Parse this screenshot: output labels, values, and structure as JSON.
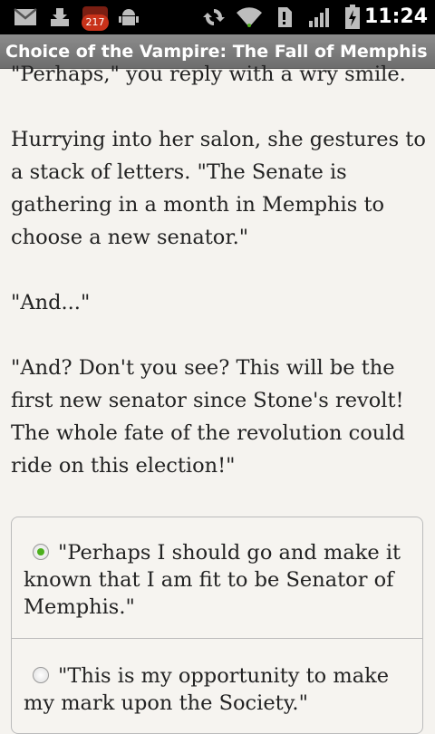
{
  "status_bar": {
    "notification_count": "217",
    "time": "11:24",
    "icons": [
      "gmail-icon",
      "download-icon",
      "app-notification-icon",
      "android-debug-icon",
      "sync-icon",
      "wifi-icon",
      "alert-icon",
      "signal-icon",
      "battery-charging-icon"
    ]
  },
  "title_bar": {
    "title": "Choice of the Vampire: The Fall of Memphis"
  },
  "story": {
    "paragraphs": [
      "\"Perhaps,\" you reply with a wry smile.",
      "Hurrying into her salon, she gestures to a stack of letters. \"The Senate is gathering in a month in Memphis to choose a new senator.\"",
      "\"And...\"",
      "\"And? Don't you see? This will be the first new senator since Stone's revolt! The whole fate of the revolution could ride on this election!\""
    ]
  },
  "choices": [
    {
      "label": "\"Perhaps I should go and make it known that I am fit to be Senator of Memphis.\"",
      "selected": true
    },
    {
      "label": "\"This is my opportunity to make my mark upon the Society.\"",
      "selected": false
    }
  ]
}
